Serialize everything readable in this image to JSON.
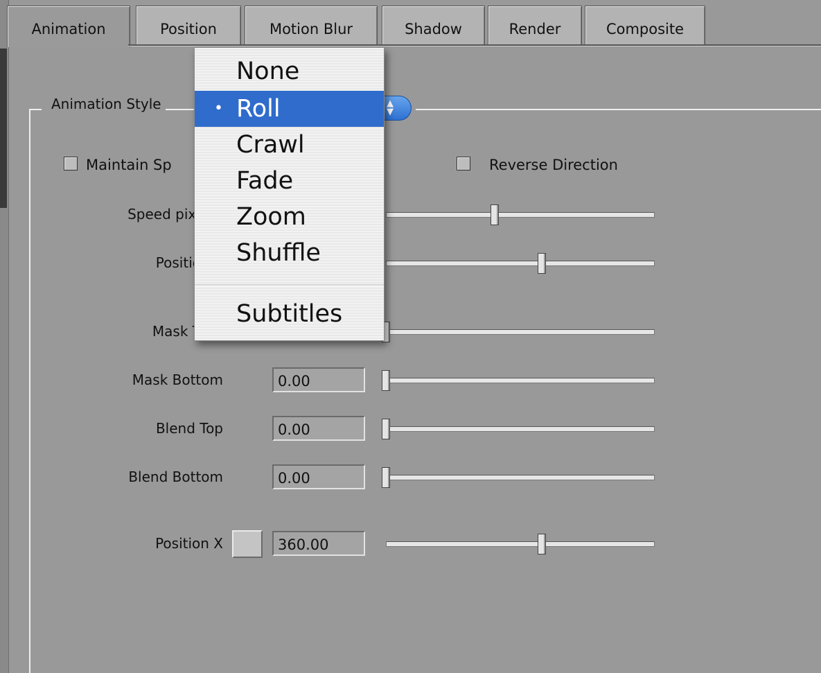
{
  "tabs": [
    {
      "label": "Animation",
      "active": true
    },
    {
      "label": "Position"
    },
    {
      "label": "Motion Blur"
    },
    {
      "label": "Shadow"
    },
    {
      "label": "Render"
    },
    {
      "label": "Composite"
    }
  ],
  "group": {
    "label": "Animation Style"
  },
  "checkboxes": {
    "maintain_speed": {
      "label": "Maintain Sp",
      "checked": false
    },
    "reverse_direction": {
      "label": "Reverse Direction",
      "checked": false
    }
  },
  "rows": {
    "speed": {
      "label": "Speed pix/"
    },
    "position": {
      "label": "Positio"
    },
    "mask_top": {
      "label": "Mask T"
    },
    "mask_bottom": {
      "label": "Mask Bottom",
      "value": "0.00"
    },
    "blend_top": {
      "label": "Blend Top",
      "value": "0.00"
    },
    "blend_bottom": {
      "label": "Blend Bottom",
      "value": "0.00"
    },
    "position_x": {
      "label": "Position X",
      "value": "360.00"
    }
  },
  "menu": {
    "items": [
      {
        "label": "None"
      },
      {
        "label": "Roll",
        "selected": true,
        "marker": "•"
      },
      {
        "label": "Crawl"
      },
      {
        "label": "Fade"
      },
      {
        "label": "Zoom"
      },
      {
        "label": "Shuffle"
      },
      {
        "label": "Subtitles"
      }
    ]
  },
  "colors": {
    "selection": "#2f6ccb",
    "panel": "#999999"
  }
}
